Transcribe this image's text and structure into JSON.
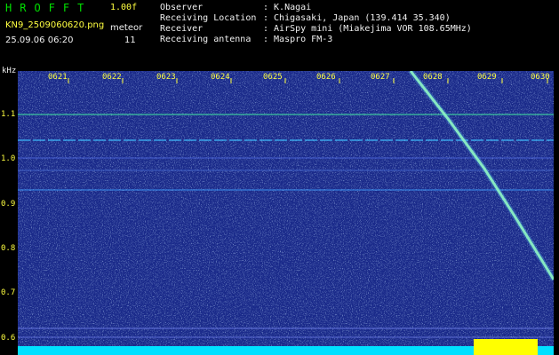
{
  "header": {
    "title": "HROFFT",
    "version": "1.00f",
    "filename": "KN9_2509060620.png",
    "type_label": "meteor",
    "timestamp": "25.09.06 06:20",
    "count": "11"
  },
  "meta": [
    {
      "label": "Observer",
      "value": ": K.Nagai"
    },
    {
      "label": "Receiving Location",
      "value": ": Chigasaki, Japan (139.414 35.340)"
    },
    {
      "label": "Receiver",
      "value": ": AirSpy mini (Miakejima VOR 108.65MHz)"
    },
    {
      "label": "Receiving antenna",
      "value": ": Maspro FM-3"
    }
  ],
  "axis": {
    "y_unit": "kHz",
    "y_ticks": [
      "1.1",
      "1.0",
      "0.9",
      "0.8",
      "0.7",
      "0.6"
    ],
    "x_ticks": [
      "0621",
      "0622",
      "0623",
      "0624",
      "0625",
      "0626",
      "0627",
      "0628",
      "0629",
      "0630"
    ]
  },
  "colors": {
    "background": "#1a2a8a",
    "trail": "#a0ffb0",
    "bar": "#00e0ff",
    "burst": "#ffff00"
  }
}
